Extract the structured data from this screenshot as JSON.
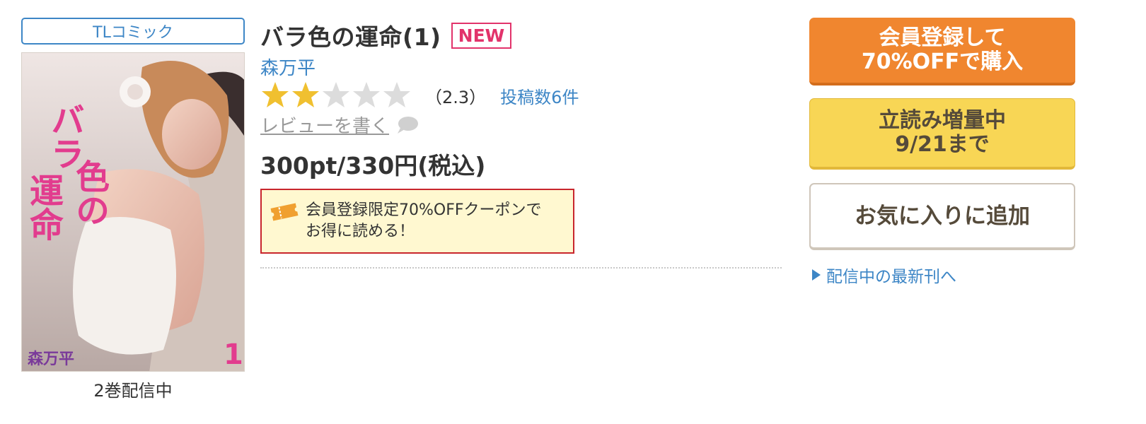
{
  "genre_label": "TLコミック",
  "cover": {
    "title_vertical_1": "バラ",
    "title_vertical_2": "色の",
    "title_vertical_3": "運命",
    "author_on_cover": "森万平",
    "volume_mark": "1"
  },
  "volumes_available": "2巻配信中",
  "title": "バラ色の運命(1)",
  "new_badge": "NEW",
  "author": "森万平",
  "rating": {
    "score": 2.3,
    "max": 5,
    "score_text": "（2.3）",
    "post_count_text": "投稿数6件",
    "star_color": "#f0c030",
    "empty_star_color": "#dcdcdc"
  },
  "write_review": "レビューを書く",
  "price": "300pt/330円(税込)",
  "coupon": {
    "line1": "会員登録限定70%OFFクーポンで",
    "line2": "お得に読める！",
    "icon": "ticket-icon"
  },
  "buttons": {
    "register_line1": "会員登録して",
    "register_line2": "70%OFFで購入",
    "preview_line1": "立読み増量中",
    "preview_line2": "9/21まで",
    "favorite": "お気に入りに追加"
  },
  "latest_link": "配信中の最新刊へ",
  "colors": {
    "link_blue": "#3d86c6",
    "register_orange": "#f0862f",
    "preview_yellow": "#f8d655",
    "new_pink": "#e2336b",
    "coupon_border": "#c8262d"
  }
}
